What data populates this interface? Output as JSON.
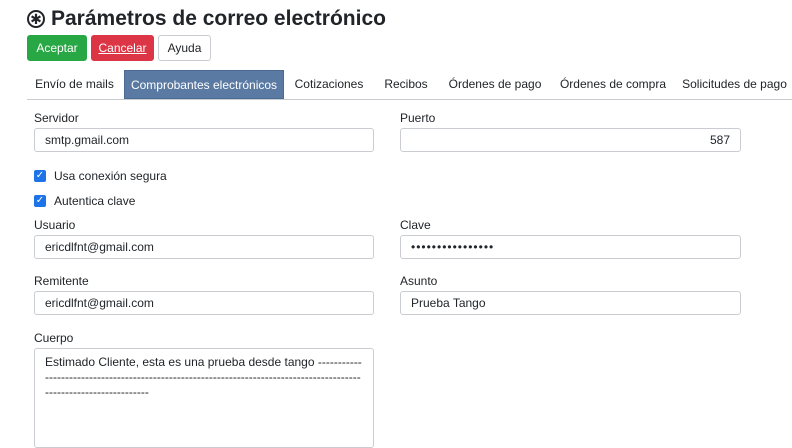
{
  "page": {
    "title": "Parámetros de correo electrónico",
    "icon": "asterisk-circle-icon"
  },
  "toolbar": {
    "accept_label": "Aceptar",
    "cancel_label": "Cancelar",
    "help_label": "Ayuda"
  },
  "tabs": [
    {
      "label": "Envío de mails",
      "active": false
    },
    {
      "label": "Comprobantes electrónicos",
      "active": true
    },
    {
      "label": "Cotizaciones",
      "active": false
    },
    {
      "label": "Recibos",
      "active": false
    },
    {
      "label": "Órdenes de pago",
      "active": false
    },
    {
      "label": "Órdenes de compra",
      "active": false
    },
    {
      "label": "Solicitudes de pago",
      "active": false
    }
  ],
  "form": {
    "servidor": {
      "label": "Servidor",
      "value": "smtp.gmail.com"
    },
    "puerto": {
      "label": "Puerto",
      "value": "587"
    },
    "secure": {
      "label": "Usa conexión segura",
      "checked": true
    },
    "auth": {
      "label": "Autentica clave",
      "checked": true
    },
    "usuario": {
      "label": "Usuario",
      "value": "ericdlfnt@gmail.com"
    },
    "clave": {
      "label": "Clave",
      "value": "••••••••••••••••"
    },
    "remitente": {
      "label": "Remitente",
      "value": "ericdlfnt@gmail.com"
    },
    "asunto": {
      "label": "Asunto",
      "value": "Prueba Tango"
    },
    "cuerpo": {
      "label": "Cuerpo",
      "value": "Estimado Cliente, esta es una prueba desde tango --------------------------------------------------------------------------------------------------------------------"
    }
  },
  "colors": {
    "accept": "#28a745",
    "cancel": "#dc3545",
    "active_tab": "#5b7aa3",
    "checkbox": "#1e73e8"
  }
}
